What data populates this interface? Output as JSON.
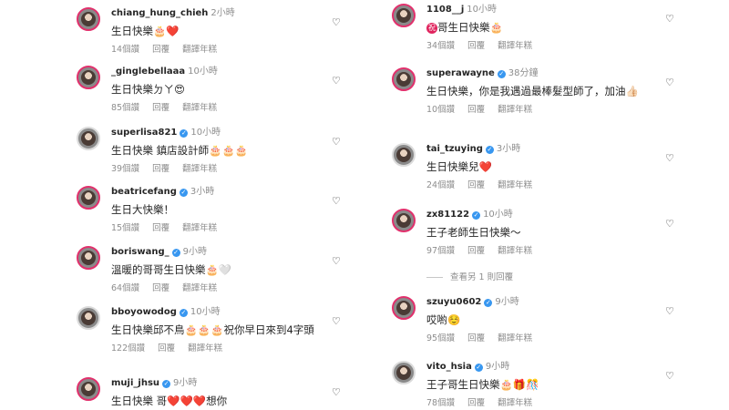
{
  "left_comments": [
    {
      "user": "chiang_hung_chieh",
      "verified": false,
      "time": "2小時",
      "text": "生日快樂🎂❤️",
      "likes": "14個讚",
      "reply": "回覆",
      "translate": "翻譯年糕"
    },
    {
      "user": "_ginglebellaaa",
      "verified": false,
      "time": "10小時",
      "text": "生日快樂ㄉㄚ😍",
      "likes": "85個讚",
      "reply": "回覆",
      "translate": "翻譯年糕"
    },
    {
      "user": "superlisa821",
      "verified": true,
      "time": "10小時",
      "text": "生日快樂 鎮店設計師🎂🎂🎂",
      "likes": "39個讚",
      "reply": "回覆",
      "translate": "翻譯年糕"
    },
    {
      "user": "beatricefang",
      "verified": true,
      "time": "3小時",
      "text": "生日大快樂！",
      "likes": "15個讚",
      "reply": "回覆",
      "translate": "翻譯年糕"
    },
    {
      "user": "boriswang_",
      "verified": true,
      "time": "9小時",
      "text": "溫暖的哥哥生日快樂🎂🤍",
      "likes": "64個讚",
      "reply": "回覆",
      "translate": "翻譯年糕"
    },
    {
      "user": "bboyowodog",
      "verified": true,
      "time": "10小時",
      "text": "生日快樂邱不鳥🎂🎂🎂祝你早日來到4字頭",
      "likes": "122個讚",
      "reply": "回覆",
      "translate": "翻譯年糕"
    },
    {
      "user": "muji_jhsu",
      "verified": true,
      "time": "9小時",
      "text": "生日快樂 哥❤️❤️❤️想你",
      "likes": "",
      "reply": "",
      "translate": ""
    }
  ],
  "right_comments": [
    {
      "user": "1108__j",
      "verified": false,
      "time": "10小時",
      "badge": "祝",
      "text": "哥生日快樂🎂",
      "likes": "34個讚",
      "reply": "回覆",
      "translate": "翻譯年糕"
    },
    {
      "user": "superawayne",
      "verified": true,
      "time": "38分鐘",
      "text": "生日快樂，你是我遇過最棒髮型師了，加油👍🏻",
      "likes": "10個讚",
      "reply": "回覆",
      "translate": "翻譯年糕"
    },
    {
      "user": "tai_tzuying",
      "verified": true,
      "time": "3小時",
      "text": "生日快樂兒❤️",
      "likes": "24個讚",
      "reply": "回覆",
      "translate": "翻譯年糕"
    },
    {
      "user": "zx81122",
      "verified": true,
      "time": "10小時",
      "text": "王子老師生日快樂～",
      "likes": "97個讚",
      "reply": "回覆",
      "translate": "翻譯年糕"
    },
    {
      "user": "szuyu0602",
      "verified": true,
      "time": "9小時",
      "text": "哎喲☺️",
      "likes": "95個讚",
      "reply": "回覆",
      "translate": "翻譯年糕"
    },
    {
      "user": "vito_hsia",
      "verified": true,
      "time": "9小時",
      "text": "王子哥生日快樂🎂🎁🎊",
      "likes": "78個讚",
      "reply": "回覆",
      "translate": "翻譯年糕"
    }
  ],
  "view_replies": "查看另 1 則回覆",
  "icons": {
    "like": "heart-outline-icon",
    "verified": "verified-badge-icon"
  },
  "colors": {
    "verified": "#3897f0",
    "story_ring": "#e1306c",
    "meta": "#8e8e8e"
  }
}
